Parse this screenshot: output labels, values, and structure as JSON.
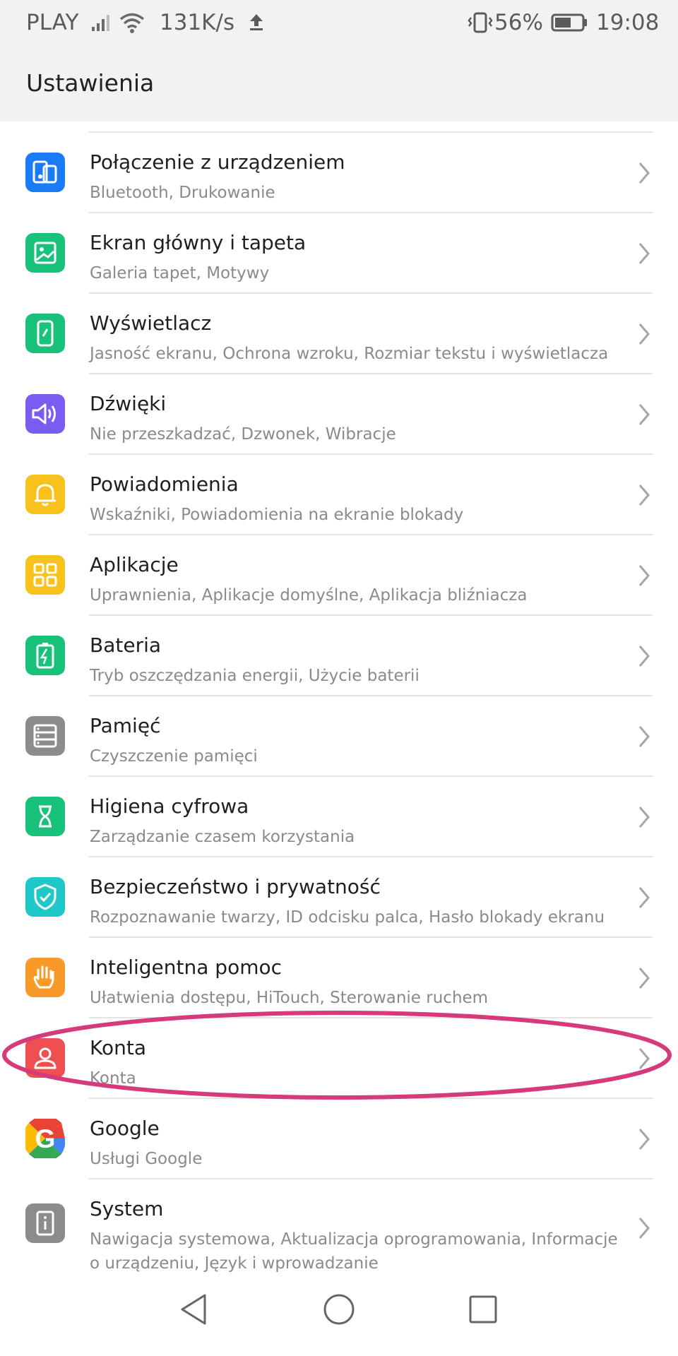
{
  "status_bar": {
    "carrier": "PLAY",
    "speed": "131K/s",
    "battery_percent": "56%",
    "time": "19:08",
    "icons": [
      "signal-icon",
      "wifi-icon",
      "upload-icon",
      "vibrate-icon",
      "battery-icon"
    ]
  },
  "header": {
    "title": "Ustawienia"
  },
  "items": [
    {
      "label": "Połączenie z urządzeniem",
      "sub": "Bluetooth, Drukowanie",
      "icon": "device-connection-icon",
      "color": "#1a7cf4"
    },
    {
      "label": "Ekran główny i tapeta",
      "sub": "Galeria tapet, Motywy",
      "icon": "wallpaper-icon",
      "color": "#19c27a"
    },
    {
      "label": "Wyświetlacz",
      "sub": "Jasność ekranu, Ochrona wzroku, Rozmiar tekstu i wyświetlacza",
      "icon": "display-icon",
      "color": "#19c27a"
    },
    {
      "label": "Dźwięki",
      "sub": "Nie przeszkadzać, Dzwonek, Wibracje",
      "icon": "sound-icon",
      "color": "#7b5cf0"
    },
    {
      "label": "Powiadomienia",
      "sub": "Wskaźniki, Powiadomienia na ekranie blokady",
      "icon": "bell-icon",
      "color": "#f7c21b"
    },
    {
      "label": "Aplikacje",
      "sub": "Uprawnienia, Aplikacje domyślne, Aplikacja bliźniacza",
      "icon": "apps-grid-icon",
      "color": "#f7c21b"
    },
    {
      "label": "Bateria",
      "sub": "Tryb oszczędzania energii, Użycie baterii",
      "icon": "battery-charging-icon",
      "color": "#19c27a"
    },
    {
      "label": "Pamięć",
      "sub": "Czyszczenie pamięci",
      "icon": "storage-icon",
      "color": "#8c8c8c"
    },
    {
      "label": "Higiena cyfrowa",
      "sub": "Zarządzanie czasem korzystania",
      "icon": "hourglass-icon",
      "color": "#19c27a"
    },
    {
      "label": "Bezpieczeństwo i prywatność",
      "sub": "Rozpoznawanie twarzy, ID odcisku palca, Hasło blokady ekranu",
      "icon": "shield-check-icon",
      "color": "#1fc8c8"
    },
    {
      "label": "Inteligentna pomoc",
      "sub": "Ułatwienia dostępu, HiTouch, Sterowanie ruchem",
      "icon": "hand-icon",
      "color": "#f89a2a"
    },
    {
      "label": "Konta",
      "sub": "Konta",
      "icon": "account-icon",
      "color": "#f04f52"
    },
    {
      "label": "Google",
      "sub": "Usługi Google",
      "icon": "google-icon",
      "color": "#ffffff"
    },
    {
      "label": "System",
      "sub": "Nawigacja systemowa, Aktualizacja oprogramowania, Informacje o urządzeniu, Język i wprowadzanie",
      "icon": "system-info-icon",
      "color": "#8c8c8c"
    }
  ],
  "highlight_color": "#d63a7a",
  "nav_bar": {
    "buttons": [
      "back-icon",
      "home-icon",
      "recents-icon"
    ]
  }
}
